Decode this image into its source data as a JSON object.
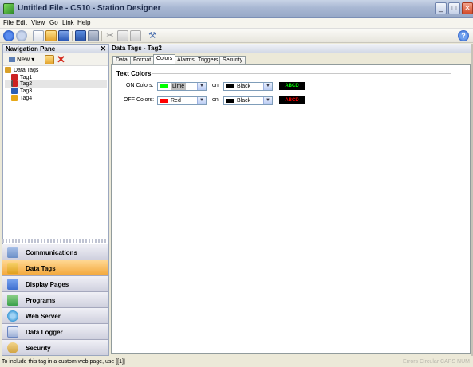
{
  "window": {
    "title": "Untitled File - CS10 - Station Designer"
  },
  "menubar": {
    "items": [
      {
        "label": "File",
        "key": "F"
      },
      {
        "label": "Edit",
        "key": "E"
      },
      {
        "label": "View",
        "key": "V"
      },
      {
        "label": "Go",
        "key": "G"
      },
      {
        "label": "Link",
        "key": "L"
      },
      {
        "label": "Help",
        "key": "H"
      }
    ]
  },
  "navpane": {
    "title": "Navigation Pane",
    "new_label": "New",
    "tree": [
      {
        "label": "Data Tags",
        "icon": "folder-tags-icon",
        "color": "#d9a028"
      },
      {
        "label": "Tag1",
        "icon": "tag-red-icon",
        "color": "#cc2222"
      },
      {
        "label": "Tag2",
        "icon": "tag-flag-icon",
        "color": "#cc2222",
        "selected": true
      },
      {
        "label": "Tag3",
        "icon": "tag-blue-icon",
        "color": "#2b5fb5"
      },
      {
        "label": "Tag4",
        "icon": "tag-yellow-icon",
        "color": "#e7a817"
      }
    ],
    "categories": [
      {
        "label": "Communications",
        "icon": "communications-icon",
        "color": "#6b8fc7"
      },
      {
        "label": "Data Tags",
        "icon": "data-tags-icon",
        "color": "#e0a020",
        "active": true
      },
      {
        "label": "Display Pages",
        "icon": "display-pages-icon",
        "color": "#3f6fcf"
      },
      {
        "label": "Programs",
        "icon": "programs-icon",
        "color": "#3aa04a"
      },
      {
        "label": "Web Server",
        "icon": "web-server-icon",
        "color": "#3c9ad6"
      },
      {
        "label": "Data Logger",
        "icon": "data-logger-icon",
        "color": "#6a86c0"
      },
      {
        "label": "Security",
        "icon": "security-icon",
        "color": "#d0a240"
      }
    ]
  },
  "main": {
    "title": "Data Tags - Tag2",
    "tabs": [
      "Data",
      "Format",
      "Colors",
      "Alarms",
      "Triggers",
      "Security"
    ],
    "active_tab": "Colors",
    "group_title": "Text Colors",
    "rows": [
      {
        "label": "ON Colors:",
        "fg": {
          "value": "Lime",
          "color": "#00ff00"
        },
        "on": "on",
        "bg": {
          "value": "Black",
          "color": "#000000"
        },
        "preview": "ABCD",
        "preview_color": "#00ff00"
      },
      {
        "label": "OFF Colors:",
        "fg": {
          "value": "Red",
          "color": "#ff0000"
        },
        "on": "on",
        "bg": {
          "value": "Black",
          "color": "#000000"
        },
        "preview": "ABCD",
        "preview_color": "#ff0000"
      }
    ]
  },
  "statusbar": {
    "text": "To include this tag in a custom web page, use [[1]]",
    "right": "Errors Circular CAPS NUM"
  }
}
